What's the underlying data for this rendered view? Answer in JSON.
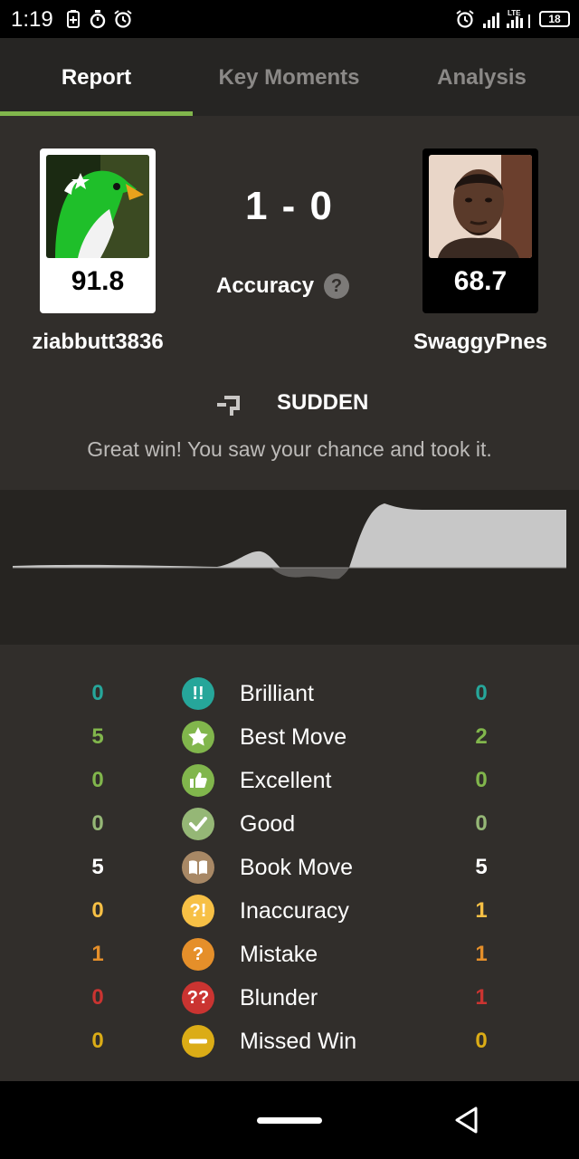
{
  "status_bar": {
    "time": "1:19",
    "signal_label": "LTE",
    "battery": "18"
  },
  "tabs": [
    {
      "label": "Report",
      "active": true
    },
    {
      "label": "Key Moments",
      "active": false
    },
    {
      "label": "Analysis",
      "active": false
    }
  ],
  "report": {
    "white_player": {
      "name": "ziabbutt3836",
      "accuracy": "91.8"
    },
    "black_player": {
      "name": "SwaggyPnes",
      "accuracy": "68.7"
    },
    "score": "1 - 0",
    "accuracy_label": "Accuracy",
    "game_type": "SUDDEN",
    "summary": "Great win! You saw your chance and took it."
  },
  "stats": [
    {
      "label": "Brilliant",
      "white": "0",
      "black": "0",
      "color": "#26a69a",
      "icon": "brilliant-icon"
    },
    {
      "label": "Best Move",
      "white": "5",
      "black": "2",
      "color": "#81b64c",
      "icon": "star-icon"
    },
    {
      "label": "Excellent",
      "white": "0",
      "black": "0",
      "color": "#81b64c",
      "icon": "thumbs-up-icon"
    },
    {
      "label": "Good",
      "white": "0",
      "black": "0",
      "color": "#95b776",
      "icon": "check-icon"
    },
    {
      "label": "Book Move",
      "white": "5",
      "black": "5",
      "color": "#a88865",
      "icon": "book-icon"
    },
    {
      "label": "Inaccuracy",
      "white": "0",
      "black": "1",
      "color": "#f7c045",
      "icon": "inaccuracy-icon"
    },
    {
      "label": "Mistake",
      "white": "1",
      "black": "1",
      "color": "#e58f2a",
      "icon": "mistake-icon"
    },
    {
      "label": "Blunder",
      "white": "0",
      "black": "1",
      "color": "#ca3431",
      "icon": "blunder-icon"
    },
    {
      "label": "Missed Win",
      "white": "0",
      "black": "0",
      "color": "#dbac16",
      "icon": "missed-win-icon"
    }
  ]
}
